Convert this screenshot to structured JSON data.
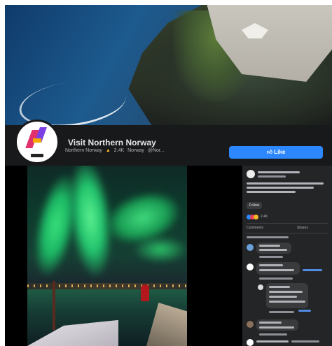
{
  "cover": {
    "alt": ""
  },
  "page": {
    "name": "Visit Northern Norway",
    "meta_items": [
      "Northern Norway",
      "2.4K",
      "Norway",
      "@Nor..."
    ],
    "like_button": "Like"
  },
  "side": {
    "follow_label": "Follow",
    "react_count": "2.4K",
    "comment_labels": [
      "Comments",
      "Shares"
    ]
  },
  "colors": {
    "brand_blue": "#2d88ff",
    "dark_panel": "#18191a",
    "sidebar": "#242526"
  }
}
